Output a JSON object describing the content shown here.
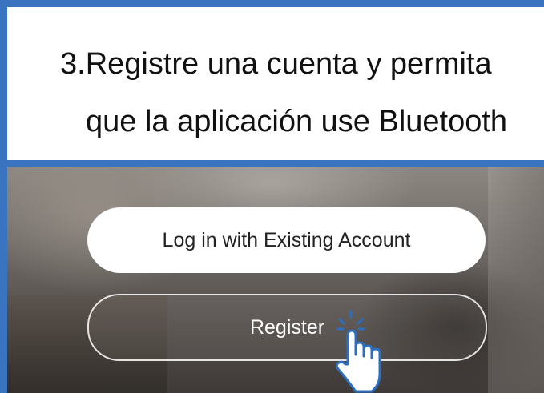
{
  "caption": {
    "line1": "3.Registre una cuenta y permita",
    "line2": "que la aplicación use Bluetooth"
  },
  "screen": {
    "login_label": "Log in with Existing Account",
    "register_label": "Register"
  },
  "colors": {
    "frame_border": "#3a73c0",
    "hand_icon": "#2b6fc0"
  },
  "icons": [
    "tap-hand-icon"
  ]
}
